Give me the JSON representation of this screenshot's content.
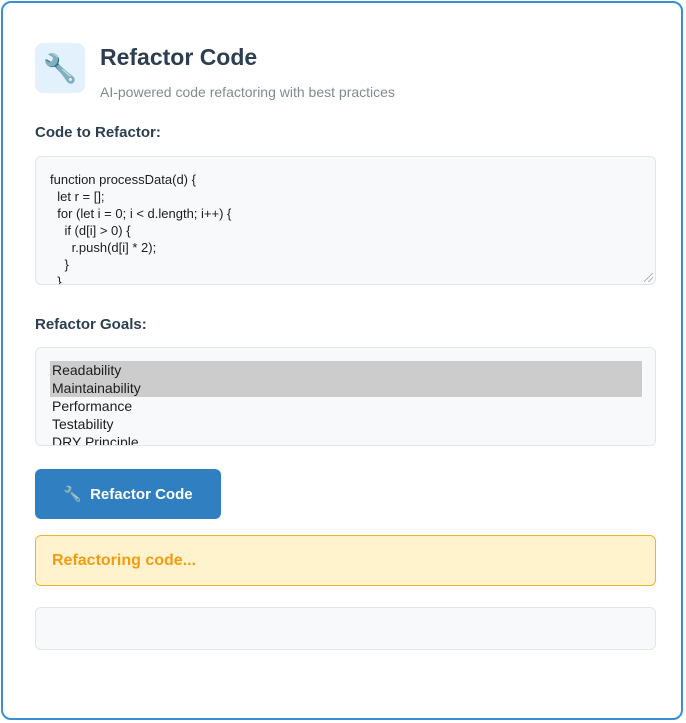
{
  "header": {
    "icon": "wrench-icon",
    "icon_glyph": "🔧",
    "title": "Refactor Code",
    "subtitle": "AI-powered code refactoring with best practices"
  },
  "code_section": {
    "label": "Code to Refactor:",
    "value": "function processData(d) {\n  let r = [];\n  for (let i = 0; i < d.length; i++) {\n    if (d[i] > 0) {\n      r.push(d[i] * 2);\n    }\n  }\n  return r;\n}"
  },
  "goals_section": {
    "label": "Refactor Goals:",
    "options": [
      {
        "label": "Readability",
        "selected": true
      },
      {
        "label": "Maintainability",
        "selected": true
      },
      {
        "label": "Performance",
        "selected": false
      },
      {
        "label": "Testability",
        "selected": false
      },
      {
        "label": "DRY Principle",
        "selected": false
      }
    ]
  },
  "button": {
    "icon_glyph": "🔧",
    "label": "Refactor Code"
  },
  "status": {
    "text": "Refactoring code..."
  },
  "colors": {
    "accent": "#2f7fc1",
    "border": "#3b8fd0",
    "warning_bg": "#fff3cd",
    "warning_text": "#f39c12"
  }
}
